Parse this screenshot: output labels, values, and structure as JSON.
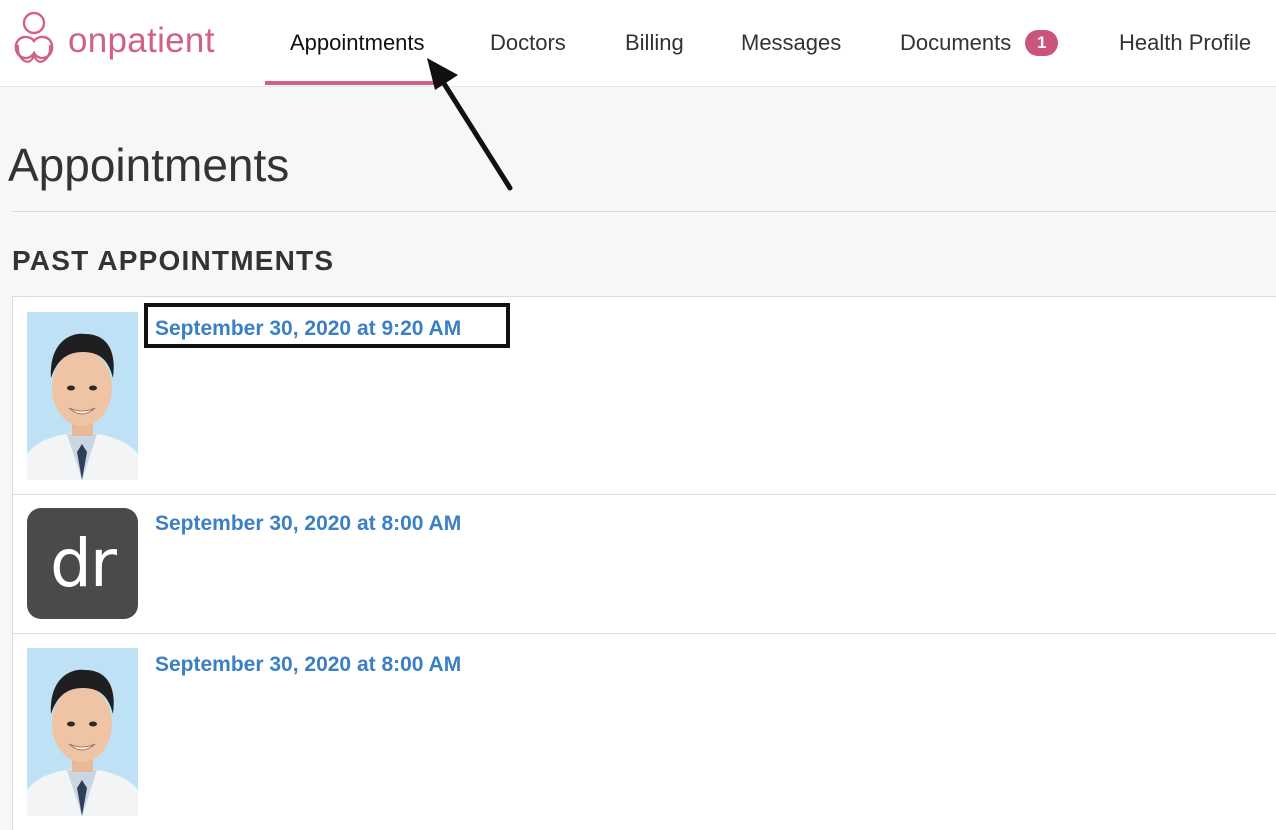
{
  "brand": {
    "name": "onpatient",
    "color": "#d06189"
  },
  "nav": {
    "items": [
      {
        "label": "Appointments",
        "active": true
      },
      {
        "label": "Doctors"
      },
      {
        "label": "Billing"
      },
      {
        "label": "Messages"
      },
      {
        "label": "Documents",
        "badge": "1"
      },
      {
        "label": "Health Profile"
      }
    ],
    "accent": "#d35f8a"
  },
  "page": {
    "title": "Appointments",
    "section_heading": "PAST APPOINTMENTS"
  },
  "appointments": [
    {
      "date": "September 30, 2020 at 9:20 AM",
      "avatar": "doctor-photo",
      "highlighted": true
    },
    {
      "date": "September 30, 2020 at 8:00 AM",
      "avatar": "dr-logo",
      "logo_text": "dr"
    },
    {
      "date": "September 30, 2020 at 8:00 AM",
      "avatar": "doctor-photo"
    }
  ],
  "colors": {
    "link": "#3b7fc4",
    "badge": "#c9557f"
  }
}
